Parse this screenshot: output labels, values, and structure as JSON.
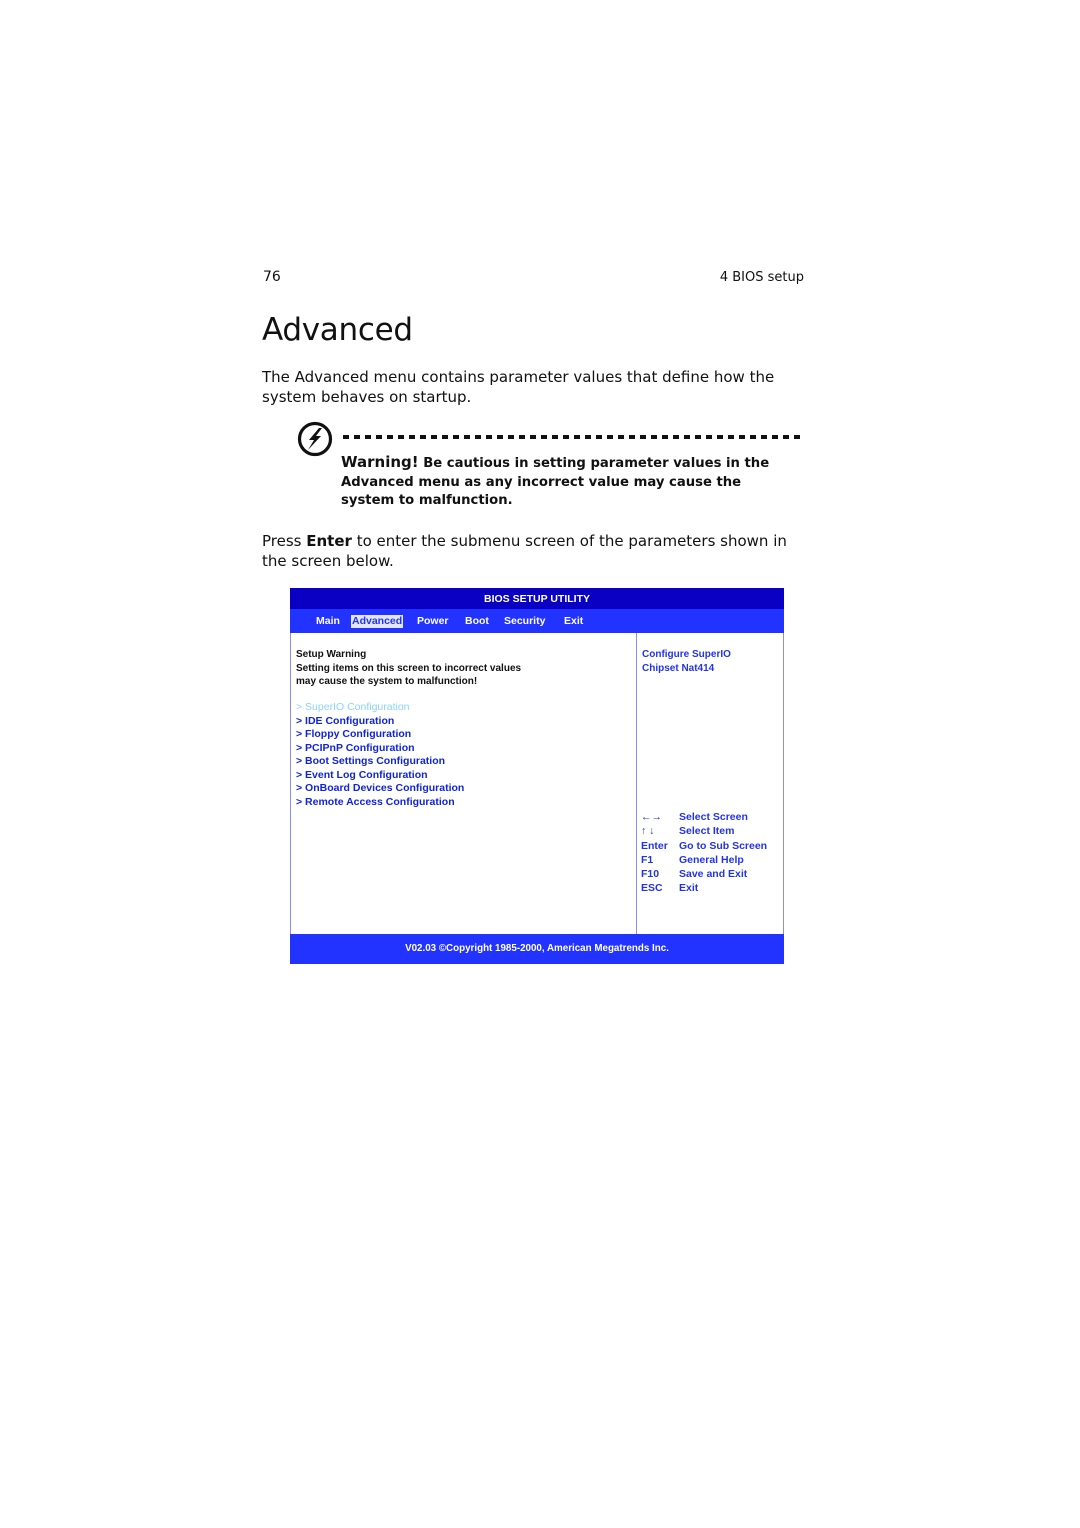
{
  "page": {
    "number": "76",
    "running_header": "4 BIOS setup",
    "title": "Advanced",
    "intro": "The Advanced menu contains parameter values that define how the system behaves on startup.",
    "warning": {
      "icon": "lightning-warning-icon",
      "lead": "Warning!",
      "text": " Be cautious in setting parameter values in the Advanced menu as any incorrect value may cause the system to malfunction."
    },
    "press_instruction": {
      "pre": "Press ",
      "key": "Enter",
      "post": " to enter the submenu screen of the parameters shown in the screen below."
    }
  },
  "bios": {
    "title": "BIOS SETUP UTILITY",
    "colors": {
      "title_bar": "#0a00c4",
      "tab_bar": "#2233ff",
      "text_blue": "#1024d8",
      "dim_item": "#8ad4f8"
    },
    "tabs": [
      {
        "label": "Main",
        "active": false
      },
      {
        "label": "Advanced",
        "active": true
      },
      {
        "label": "Power",
        "active": false
      },
      {
        "label": "Boot",
        "active": false
      },
      {
        "label": "Security",
        "active": false
      },
      {
        "label": "Exit",
        "active": false
      }
    ],
    "setup_warning": {
      "heading": "Setup Warning",
      "line1": "Setting items on this screen to incorrect values",
      "line2": "may cause the system to malfunction!"
    },
    "menu_items": [
      {
        "label": "> SuperIO Configuration",
        "highlighted": true
      },
      {
        "label": "> IDE Configuration"
      },
      {
        "label": "> Floppy Configuration"
      },
      {
        "label": "> PCIPnP Configuration"
      },
      {
        "label": "> Boot Settings Configuration"
      },
      {
        "label": "> Event Log Configuration"
      },
      {
        "label": "> OnBoard Devices Configuration"
      },
      {
        "label": "> Remote Access Configuration"
      }
    ],
    "help": {
      "line1": "Configure SuperIO",
      "line2": "Chipset Nat414"
    },
    "keys": [
      {
        "key": "←→",
        "action": "Select Screen"
      },
      {
        "key": "↑ ↓",
        "action": "Select Item"
      },
      {
        "key": "Enter",
        "action": "Go to Sub Screen"
      },
      {
        "key": "F1",
        "action": "General Help"
      },
      {
        "key": "F10",
        "action": "Save and Exit"
      },
      {
        "key": "ESC",
        "action": "Exit"
      }
    ],
    "footer": "V02.03 ©Copyright 1985-2000, American Megatrends Inc."
  }
}
